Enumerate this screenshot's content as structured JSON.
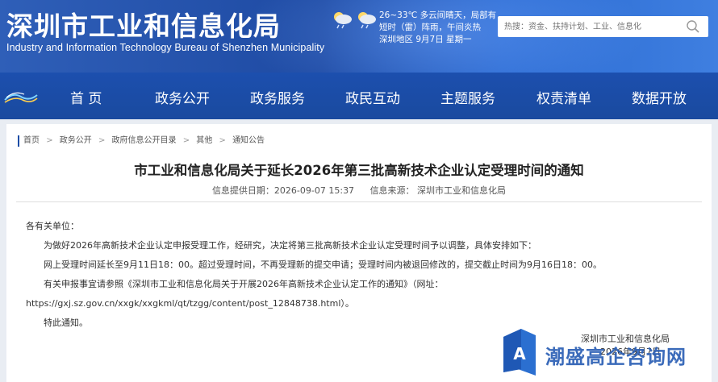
{
  "header": {
    "title": "深圳市工业和信息化局",
    "subtitle": "Industry and Information Technology Bureau of Shenzhen Municipality",
    "weather": {
      "line1": "26~33℃  多云间晴天，局部有",
      "line2": "短时（雷）阵雨，午间炎热",
      "line3": "深圳地区 9月7日  星期一"
    },
    "search": {
      "placeholder": "热搜：资金、扶持计划、工业、信息化"
    }
  },
  "nav": {
    "items": [
      {
        "label": "首 页"
      },
      {
        "label": "政务公开"
      },
      {
        "label": "政务服务"
      },
      {
        "label": "政民互动"
      },
      {
        "label": "主题服务"
      },
      {
        "label": "权责清单"
      },
      {
        "label": "数据开放"
      }
    ]
  },
  "breadcrumb": [
    "首页",
    "政务公开",
    "政府信息公开目录",
    "其他",
    "通知公告"
  ],
  "breadcrumb_sep": ">",
  "article": {
    "title": "市工业和信息化局关于延长2026年第三批高新技术企业认定受理时间的通知",
    "meta_date": "信息提供日期：2026-09-07 15:37",
    "meta_source": "信息来源：  深圳市工业和信息化局",
    "paragraphs": [
      "各有关单位：",
      "为做好2026年高新技术企业认定申报受理工作，经研究，决定将第三批高新技术企业认定受理时间予以调整，具体安排如下：",
      "网上受理时间延长至9月11日18：00。超过受理时间，不再受理新的提交申请；受理时间内被退回修改的，提交截止时间为9月16日18：00。",
      "有关申报事宜请参照《深圳市工业和信息化局关于开展2026年高新技术企业认定工作的通知》（网址：",
      "https://gxj.sz.gov.cn/xxgk/xxgkml/qt/tzgg/content/post_12848738.html）。",
      "特此通知。"
    ],
    "signature_org": "深圳市工业和信息化局",
    "signature_date": "2026年9月7日"
  },
  "watermark": {
    "text": "潮盛高企咨询网"
  },
  "colors": {
    "header_blue": "#2456b0",
    "nav_blue": "#1c4fae",
    "watermark_blue": "#2b5fb5"
  }
}
